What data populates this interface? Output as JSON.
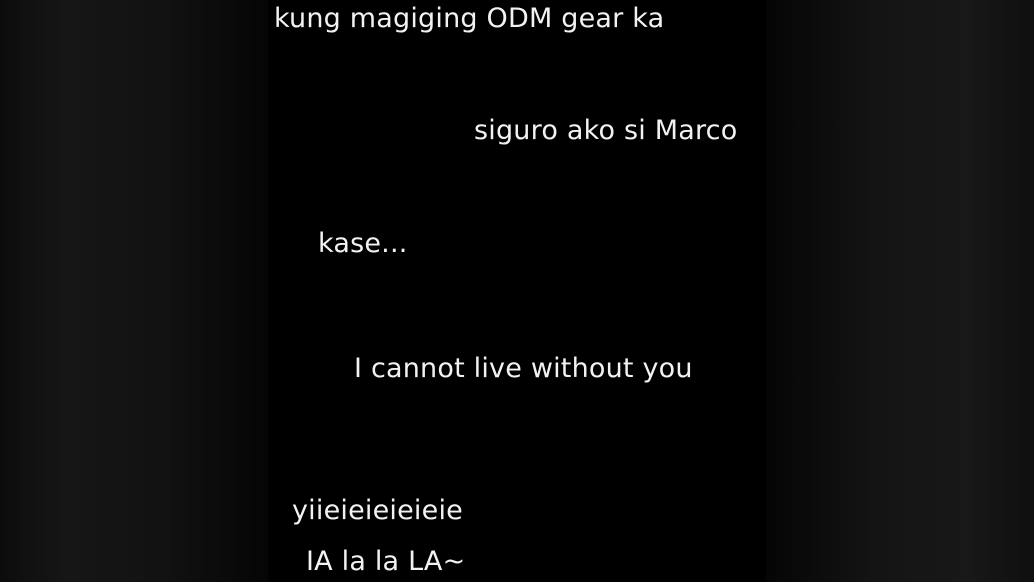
{
  "captions": [
    "kung magiging ODM gear ka",
    "siguro ako si Marco",
    "kase...",
    "I cannot live without you",
    "yiieieieieieie",
    "IA la la LA~"
  ],
  "colors": {
    "background": "#000000",
    "text": "#f2f2f2"
  }
}
